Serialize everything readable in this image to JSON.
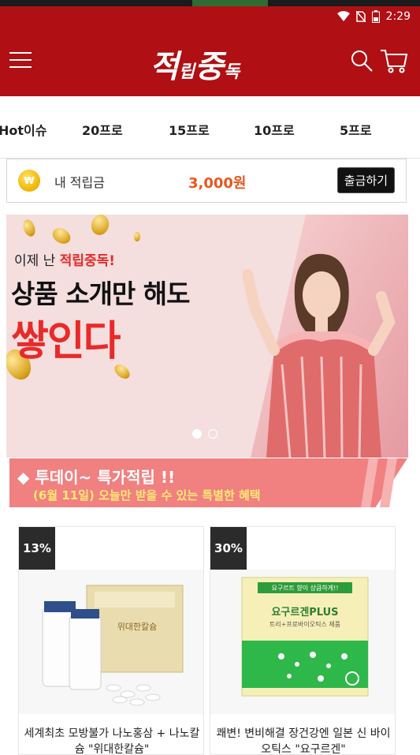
{
  "status": {
    "time": "2:29"
  },
  "header": {
    "logo_big": "적",
    "logo_small": "립",
    "logo_big2": "중",
    "logo_small2": "독"
  },
  "tabs": [
    {
      "label": "Hot이슈"
    },
    {
      "label": "20프로"
    },
    {
      "label": "15프로"
    },
    {
      "label": "10프로"
    },
    {
      "label": "5프로"
    }
  ],
  "wallet": {
    "coin_symbol": "₩",
    "label": "내 적립금",
    "amount": "3,000원",
    "button": "출금하기"
  },
  "banner": {
    "sub_prefix": "이제 난 ",
    "sub_highlight": "적립중독!",
    "line1": "상품 소개만 해도",
    "line2": "쌓인다",
    "slides": 2,
    "active_slide": 0
  },
  "promo": {
    "title": "◆ 투데이~ 특가적립 !!",
    "subtitle": "(6월 11일) 오늘만 받을 수 있는 특별한 혜택"
  },
  "products": [
    {
      "badge": "13%",
      "title": "세계최초 모방불가 나노홍삼 + 나노칼슘 \"위대한칼슘\"",
      "box_text": "위대한칼슘"
    },
    {
      "badge": "30%",
      "title": "쾌변! 변비해결 장건강엔 일본 신 바이오틱스 \"요구르겐\"",
      "box_text": "요구르겐PLUS",
      "box_top": "요구르트 향이 상큼하게!!",
      "box_sub": "트리+프로바이오틱스 제품"
    }
  ],
  "colors": {
    "brand_red": "#b01013",
    "amount_orange": "#e8571e",
    "promo_pink": "#f18080",
    "promo_yellow": "#ffe873"
  }
}
